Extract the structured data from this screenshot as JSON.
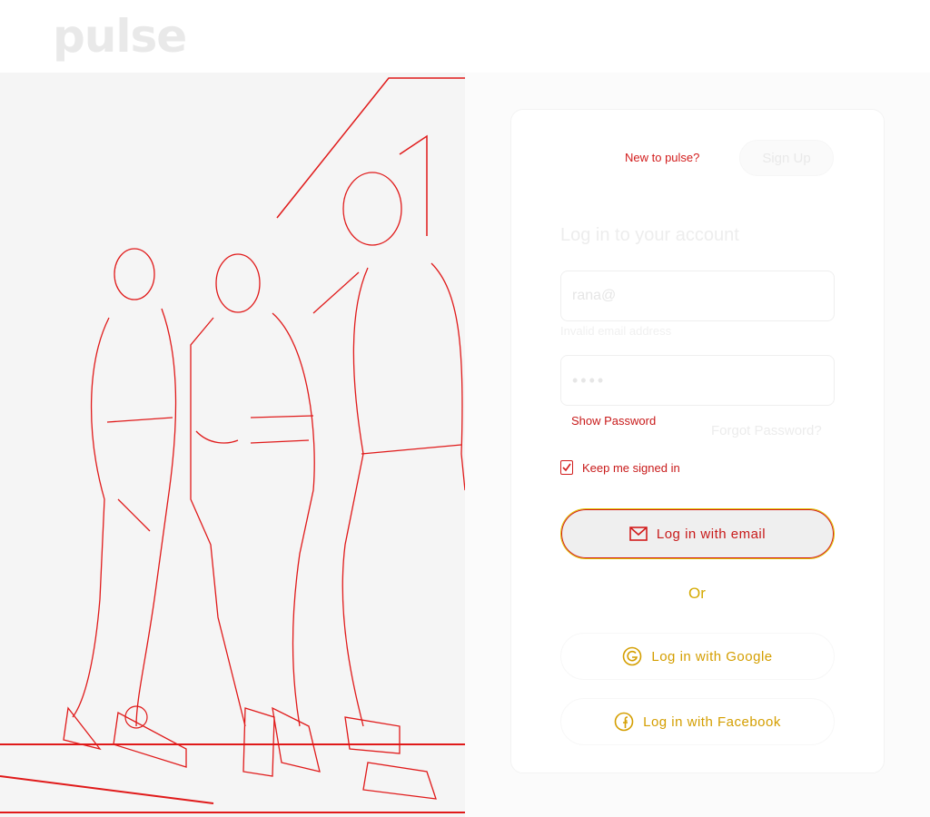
{
  "brand": {
    "logo_text": "pulse"
  },
  "auth": {
    "new_user_text": "New to pulse?",
    "signup_label": "Sign Up",
    "title": "Log in to your account",
    "email": {
      "value": "rana@",
      "error": "Invalid email address"
    },
    "password": {
      "value": "••••"
    },
    "show_password_label": "Show Password",
    "forgot_password_label": "Forgot Password?",
    "keep_signed_in_label": "Keep me signed in",
    "keep_signed_in_checked": true,
    "login_email_label": "Log in with email",
    "or_label": "Or",
    "login_google_label": "Log in with Google",
    "login_facebook_label": "Log in with Facebook"
  },
  "icons": {
    "email": "envelope-icon",
    "google": "google-icon",
    "facebook": "facebook-icon",
    "check": "check-icon"
  },
  "colors": {
    "accent_red": "#d21c1c",
    "accent_yellow": "#d4a900"
  }
}
